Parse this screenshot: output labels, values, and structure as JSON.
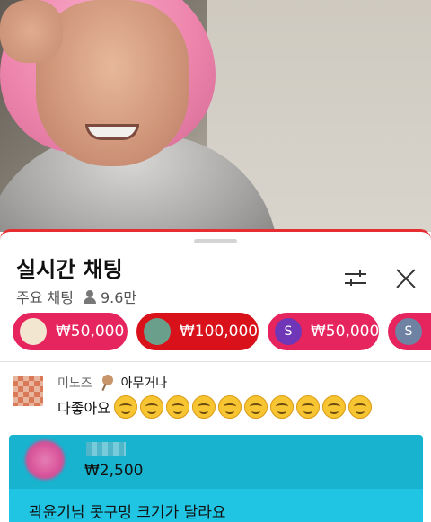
{
  "video": {
    "description_icon": "video-frame"
  },
  "chat": {
    "title": "실시간 채팅",
    "mode_label": "주요 채팅",
    "viewer_count": "9.6만"
  },
  "icons": {
    "filter": "tune-icon",
    "close": "close-icon",
    "viewers": "person-icon"
  },
  "super_chats": [
    {
      "amount": "₩50,000",
      "color": "#e6255e",
      "avatar": "",
      "avatar_color": "#f2e6d0"
    },
    {
      "amount": "₩100,000",
      "color": "#d8111a",
      "avatar": "",
      "avatar_color": "#6aa08b"
    },
    {
      "amount": "₩50,000",
      "color": "#e6255e",
      "avatar": "S",
      "avatar_color": "#6f36b7"
    },
    {
      "amount": "",
      "color": "#e6255e",
      "avatar": "S",
      "avatar_color": "#6f82a3"
    }
  ],
  "message": {
    "author": "미노즈",
    "extra_text": "아무거나",
    "text": "다좋아요",
    "emoji": "smiling-face",
    "emoji_count": 10
  },
  "super_chat_card": {
    "amount": "₩2,500",
    "text": "곽윤기님 콧구멍 크기가 달라요",
    "top_color": "#18b3cf",
    "bottom_color": "#20c5e4"
  }
}
